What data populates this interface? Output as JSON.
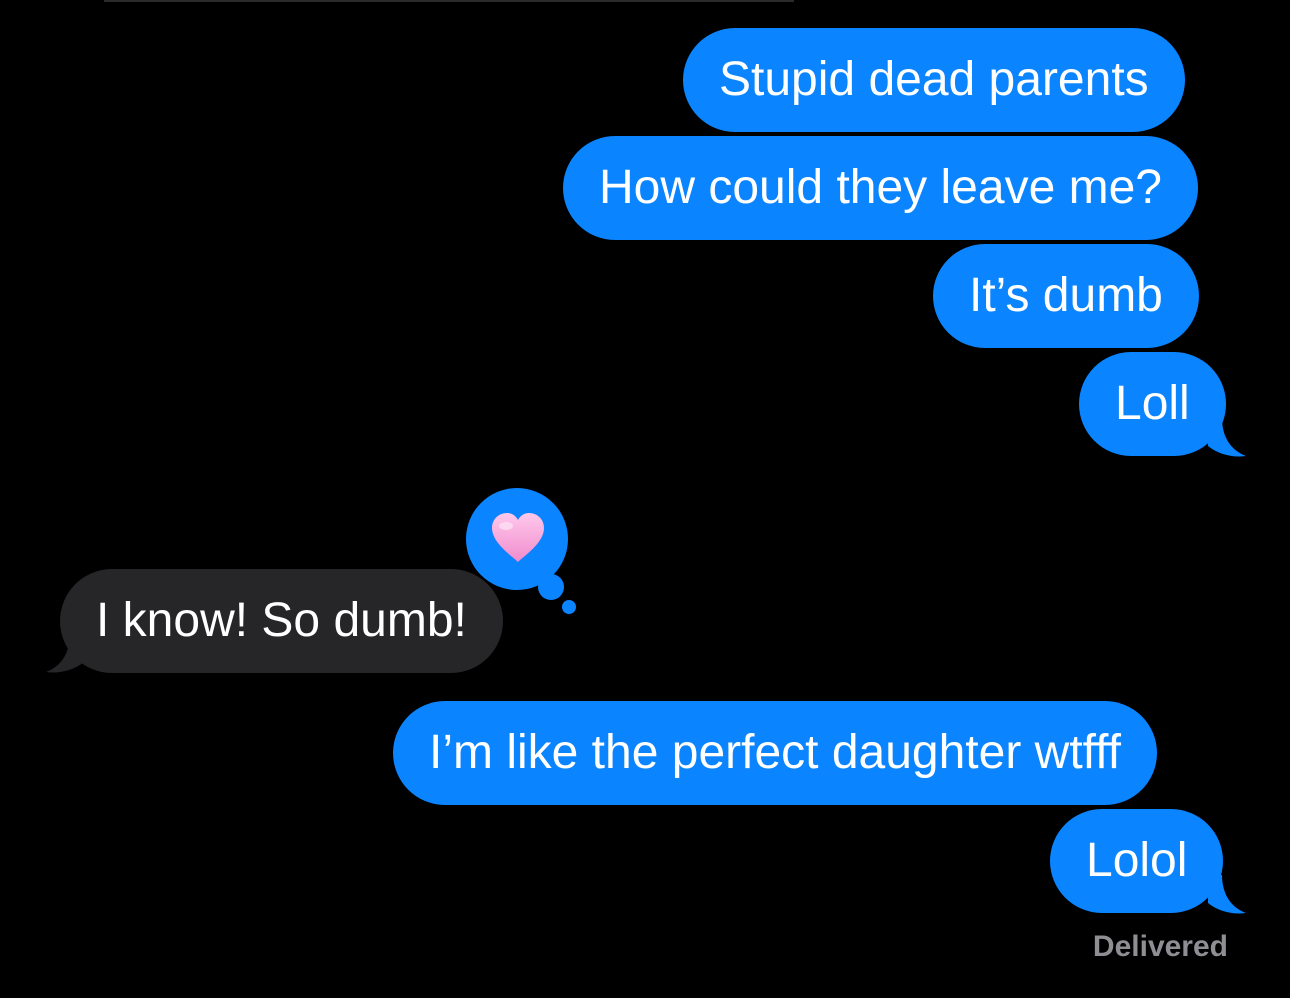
{
  "conversation": {
    "messages": [
      {
        "sender": "me",
        "text": "Stupid dead parents"
      },
      {
        "sender": "me",
        "text": "How could they leave me?"
      },
      {
        "sender": "me",
        "text": "It’s dumb"
      },
      {
        "sender": "me",
        "text": "Loll"
      },
      {
        "sender": "them",
        "text": "I know! So dumb!",
        "reaction": "heart"
      },
      {
        "sender": "me",
        "text": "I’m like the perfect daughter wtfff"
      },
      {
        "sender": "me",
        "text": "Lolol"
      }
    ],
    "status": "Delivered"
  },
  "colors": {
    "background": "#000000",
    "sent_bubble": "#0a84ff",
    "received_bubble": "#262629",
    "text": "#ffffff",
    "status_text": "#8e8e93",
    "heart": "#f7a8d8"
  },
  "icons": {
    "reaction": "heart-icon"
  }
}
